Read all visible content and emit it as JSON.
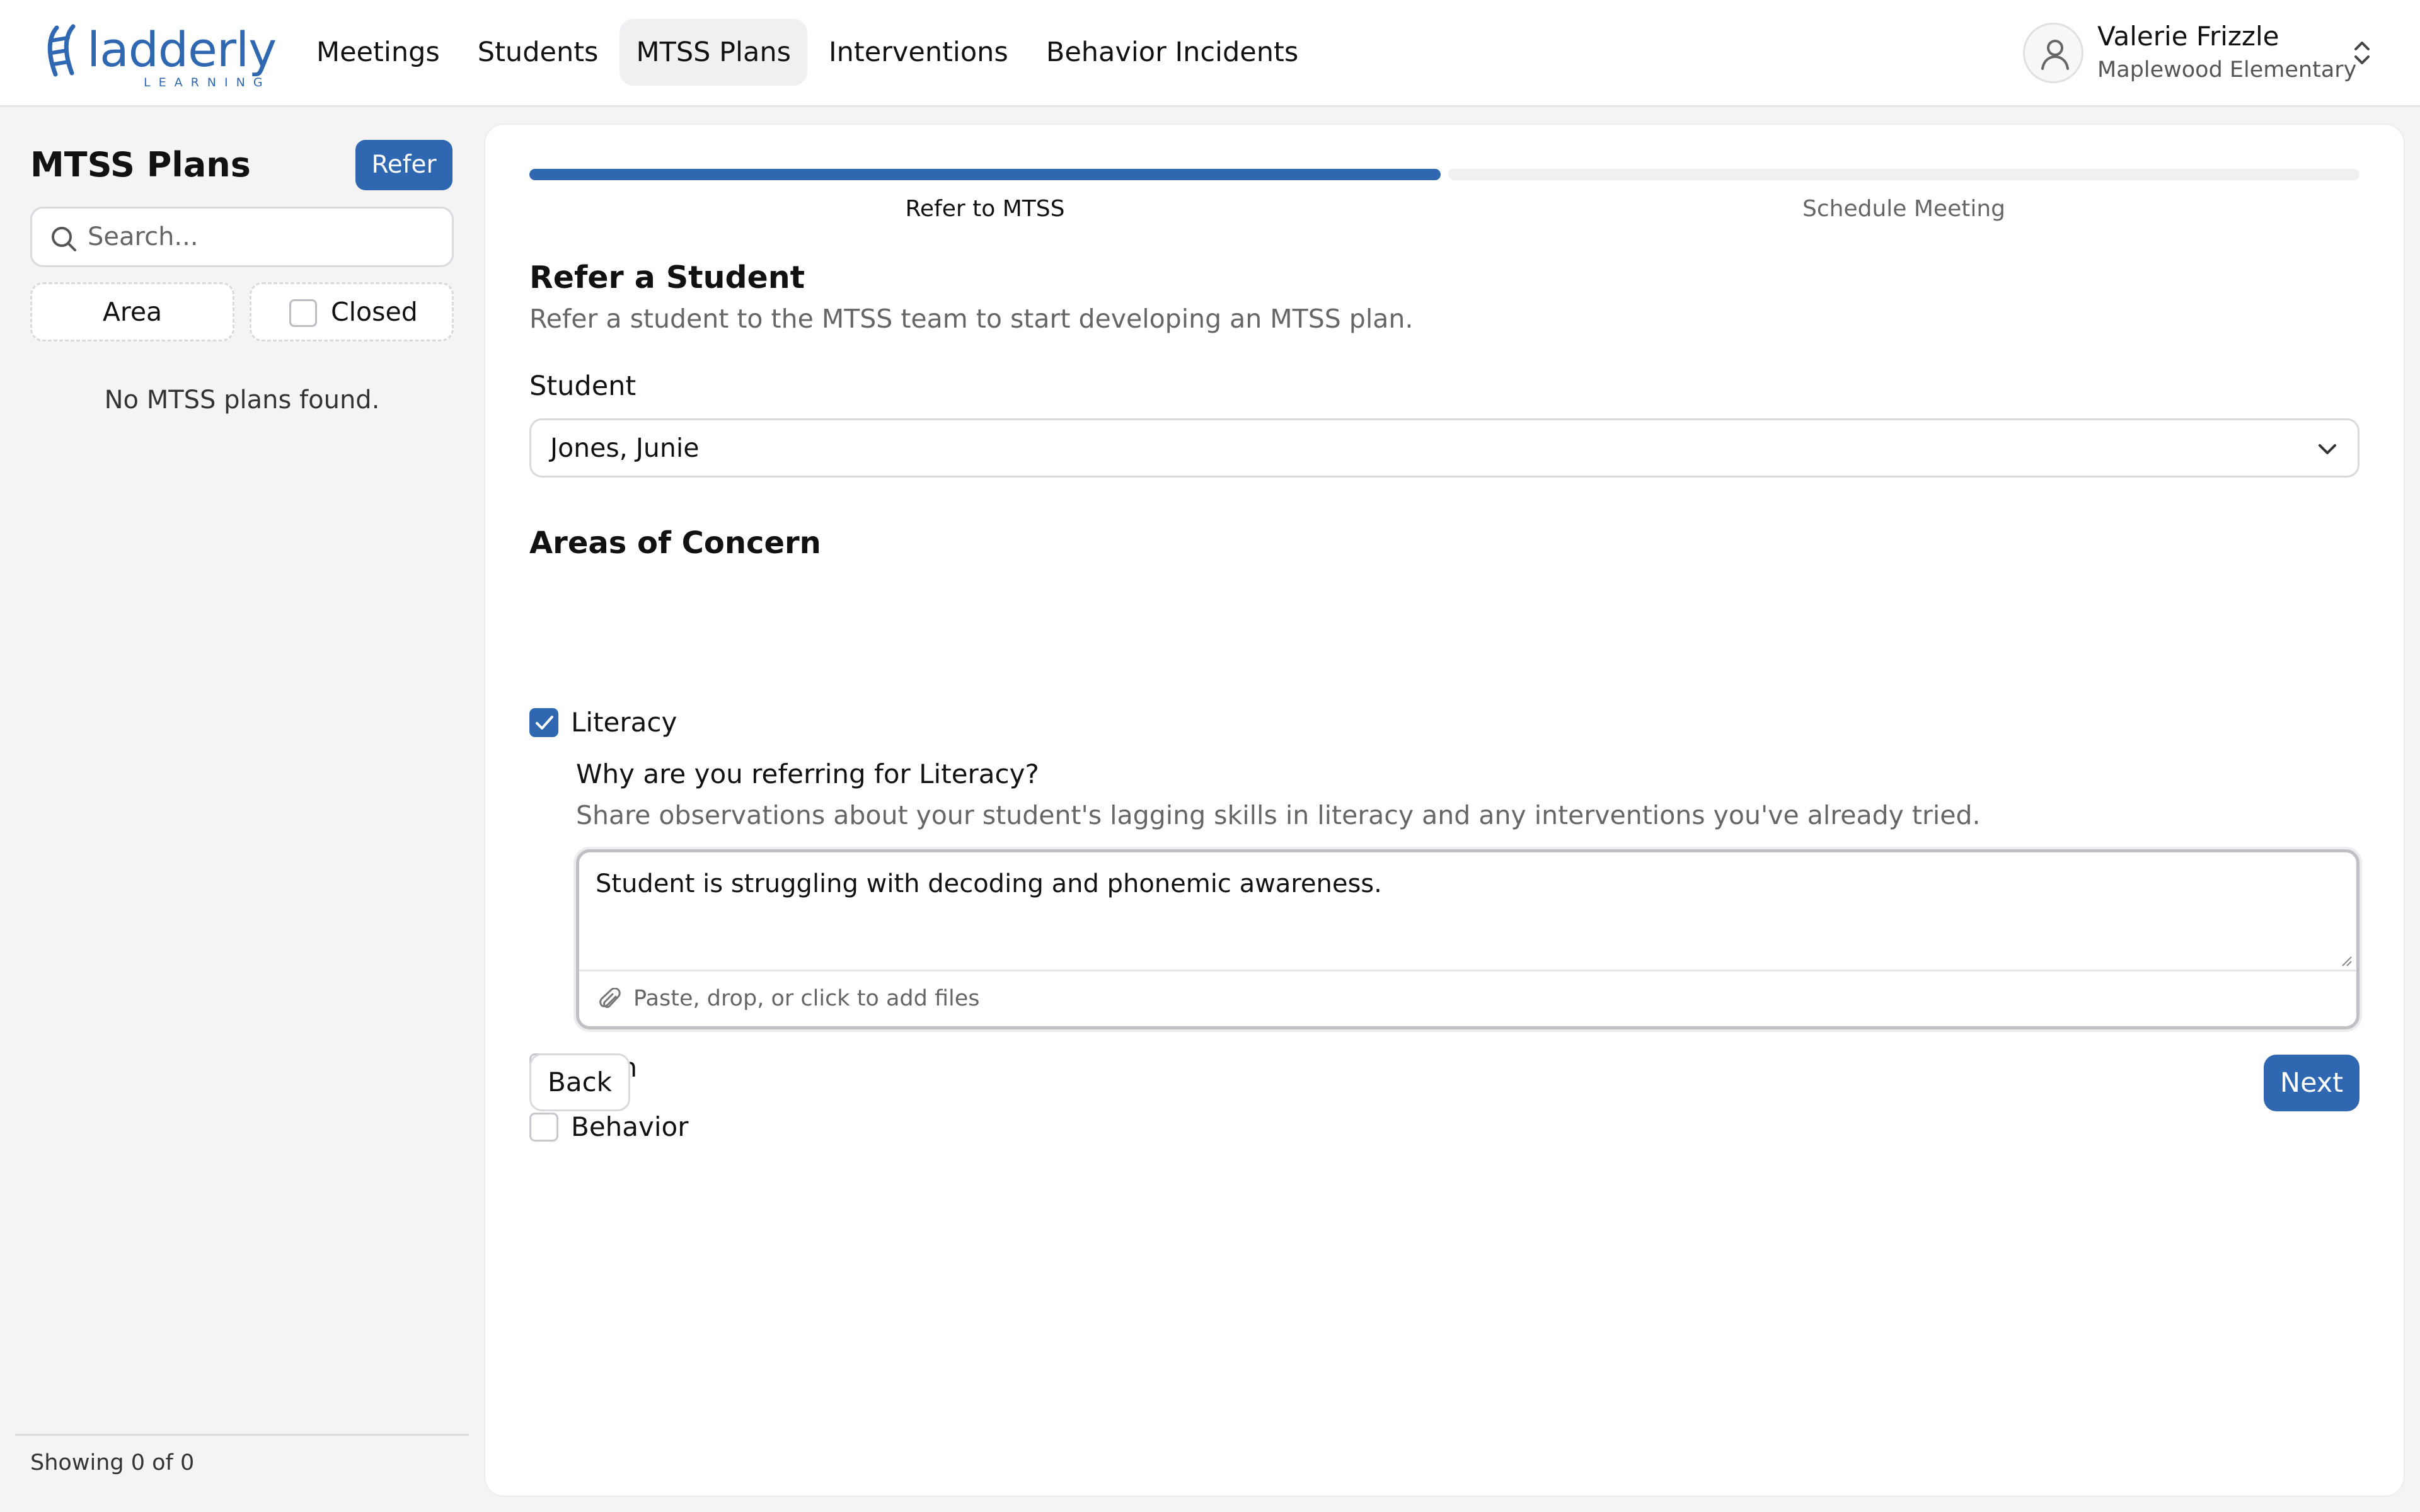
{
  "app": {
    "logo_text": "ladderly",
    "logo_subtext": "LEARNING",
    "brand_color": "#2f67b1"
  },
  "nav": {
    "items": [
      {
        "label": "Meetings"
      },
      {
        "label": "Students"
      },
      {
        "label": "MTSS Plans",
        "active": true
      },
      {
        "label": "Interventions"
      },
      {
        "label": "Behavior Incidents"
      }
    ]
  },
  "user": {
    "name": "Valerie Frizzle",
    "school": "Maplewood Elementary",
    "avatar_icon": "user-icon",
    "switch_icon": "chevron-up-down-icon"
  },
  "sidebar": {
    "title": "MTSS Plans",
    "refer_label": "Refer",
    "search_placeholder": "Search...",
    "search_value": "",
    "filter_area_label": "Area",
    "filter_closed_label": "Closed",
    "filter_closed_checked": false,
    "empty_message": "No MTSS plans found.",
    "showing_text": "Showing 0 of 0"
  },
  "wizard": {
    "progress": 0.5,
    "steps": [
      {
        "label": "Refer to MTSS",
        "active": true
      },
      {
        "label": "Schedule Meeting",
        "active": false
      }
    ]
  },
  "form": {
    "heading": "Refer a Student",
    "subheading": "Refer a student to the MTSS team to start developing an MTSS plan.",
    "student_label": "Student",
    "student_value": "Jones, Junie",
    "areas_heading": "Areas of Concern",
    "areas": [
      {
        "label": "Literacy",
        "checked": true
      },
      {
        "label": "Math",
        "checked": false
      },
      {
        "label": "Behavior",
        "checked": false
      }
    ],
    "literacy_question": "Why are you referring for Literacy?",
    "literacy_hint": "Share observations about your student's lagging skills in literacy and any interventions you've already tried.",
    "literacy_text": "Student is struggling with decoding and phonemic awareness.",
    "attach_text": "Paste, drop, or click to add files",
    "back_label": "Back",
    "next_label": "Next"
  }
}
